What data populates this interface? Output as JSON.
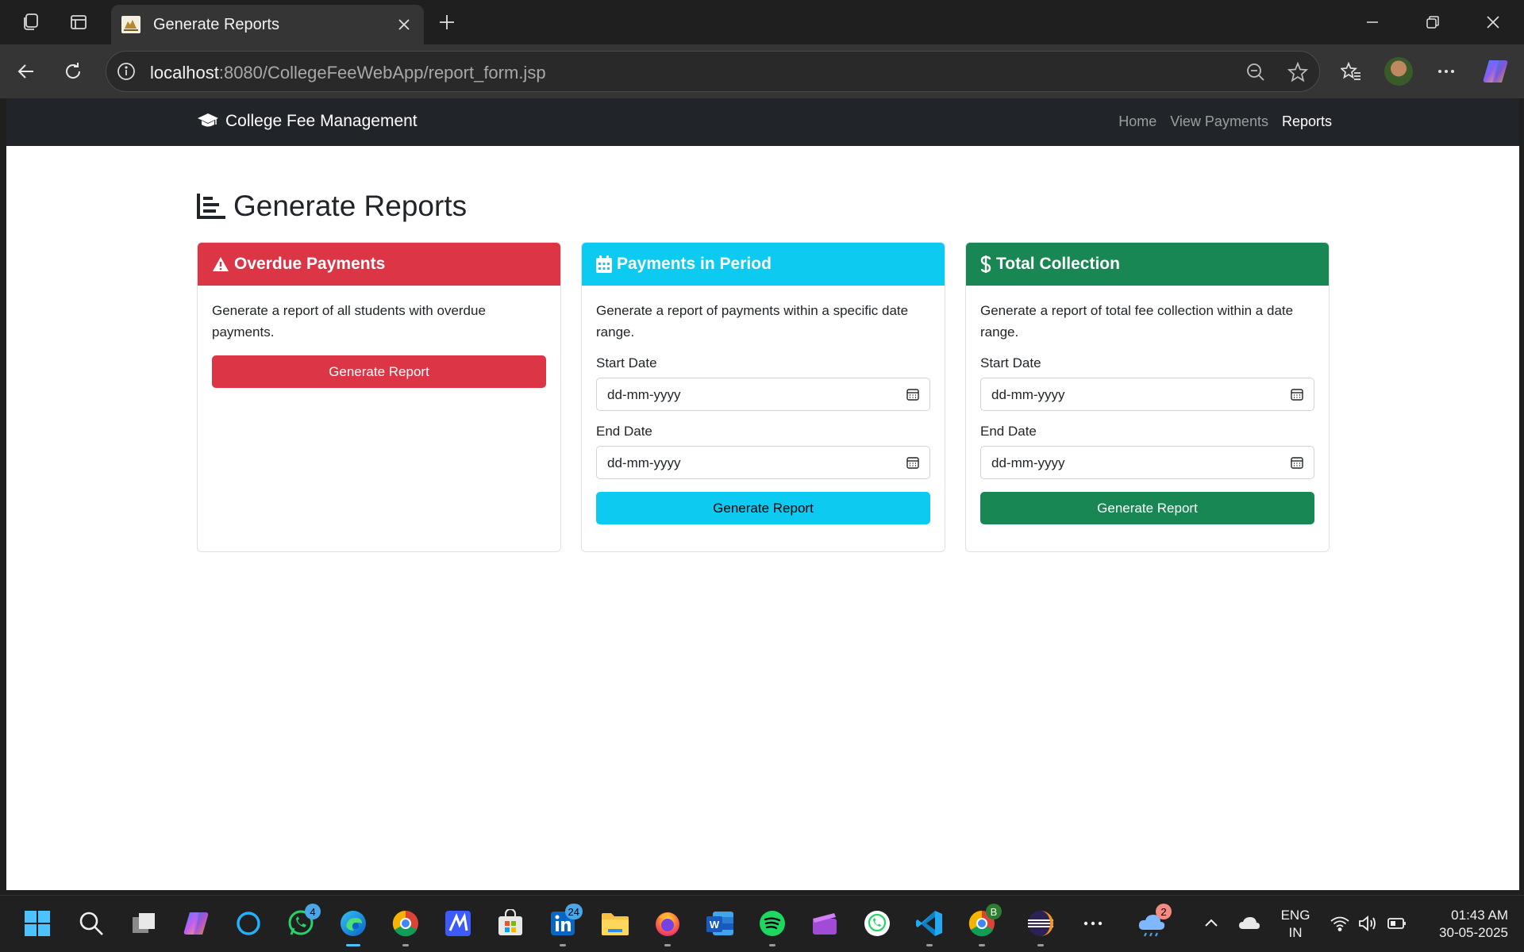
{
  "browser": {
    "tab_title": "Generate Reports",
    "url_host": "localhost",
    "url_path": ":8080/CollegeFeeWebApp/report_form.jsp"
  },
  "navbar": {
    "brand": "College Fee Management",
    "links": [
      "Home",
      "View Payments",
      "Reports"
    ]
  },
  "page": {
    "heading": "Generate Reports"
  },
  "cards": {
    "overdue": {
      "title": "Overdue Payments",
      "text": "Generate a report of all students with overdue payments.",
      "button": "Generate Report",
      "color": "#dc3545"
    },
    "period": {
      "title": "Payments in Period",
      "text": "Generate a report of payments within a specific date range.",
      "start_label": "Start Date",
      "start_placeholder": "dd-mm-yyyy",
      "end_label": "End Date",
      "end_placeholder": "dd-mm-yyyy",
      "button": "Generate Report",
      "color": "#0dcaf0"
    },
    "collection": {
      "title": "Total Collection",
      "text": "Generate a report of total fee collection within a date range.",
      "start_label": "Start Date",
      "start_placeholder": "dd-mm-yyyy",
      "end_label": "End Date",
      "end_placeholder": "dd-mm-yyyy",
      "button": "Generate Report",
      "color": "#198754"
    }
  },
  "taskbar": {
    "whatsapp_badge": "4",
    "linkedin_badge": "24",
    "chrome_profile_badge": "B",
    "weather_badge": "2",
    "language": "ENG",
    "region": "IN",
    "time": "01:43 AM",
    "date": "30-05-2025"
  }
}
